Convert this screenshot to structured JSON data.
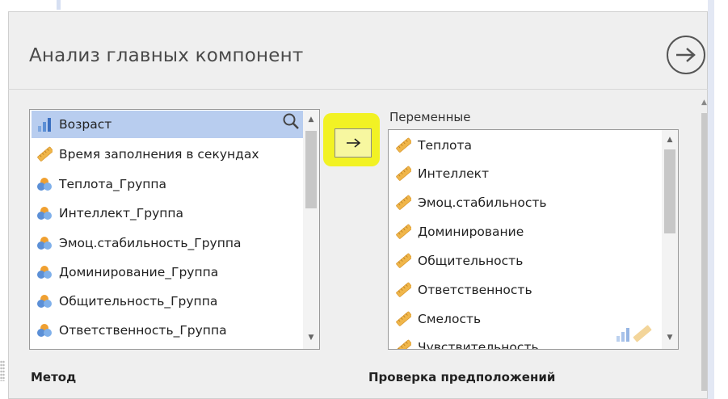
{
  "dialog": {
    "title": "Анализ главных компонент"
  },
  "source_list": {
    "items": [
      {
        "label": "Возраст",
        "icon": "continuous-bar-icon",
        "selected": true
      },
      {
        "label": "Время заполнения в секундах",
        "icon": "ruler-icon"
      },
      {
        "label": "Теплота_Группа",
        "icon": "nominal-circles-icon"
      },
      {
        "label": "Интеллект_Группа",
        "icon": "nominal-circles-icon"
      },
      {
        "label": "Эмоц.стабильность_Группа",
        "icon": "nominal-circles-icon"
      },
      {
        "label": "Доминирование_Группа",
        "icon": "nominal-circles-icon"
      },
      {
        "label": "Общительность_Группа",
        "icon": "nominal-circles-icon"
      },
      {
        "label": "Ответственность_Группа",
        "icon": "nominal-circles-icon"
      }
    ]
  },
  "transfer_button": {
    "symbol": "→"
  },
  "variables": {
    "label": "Переменные",
    "items": [
      {
        "label": "Теплота"
      },
      {
        "label": "Интеллект"
      },
      {
        "label": "Эмоц.стабильность"
      },
      {
        "label": "Доминирование"
      },
      {
        "label": "Общительность"
      },
      {
        "label": "Ответственность"
      },
      {
        "label": "Смелость"
      },
      {
        "label": "Чувствительность"
      }
    ]
  },
  "sections": {
    "method": "Метод",
    "assumptions": "Проверка предположений"
  },
  "colors": {
    "selected_row": "#b8cdef",
    "highlight": "#f2f200",
    "ruler": "#f0b64a",
    "nominal_blue": "#5b8fd6",
    "nominal_orange": "#f0a030"
  }
}
